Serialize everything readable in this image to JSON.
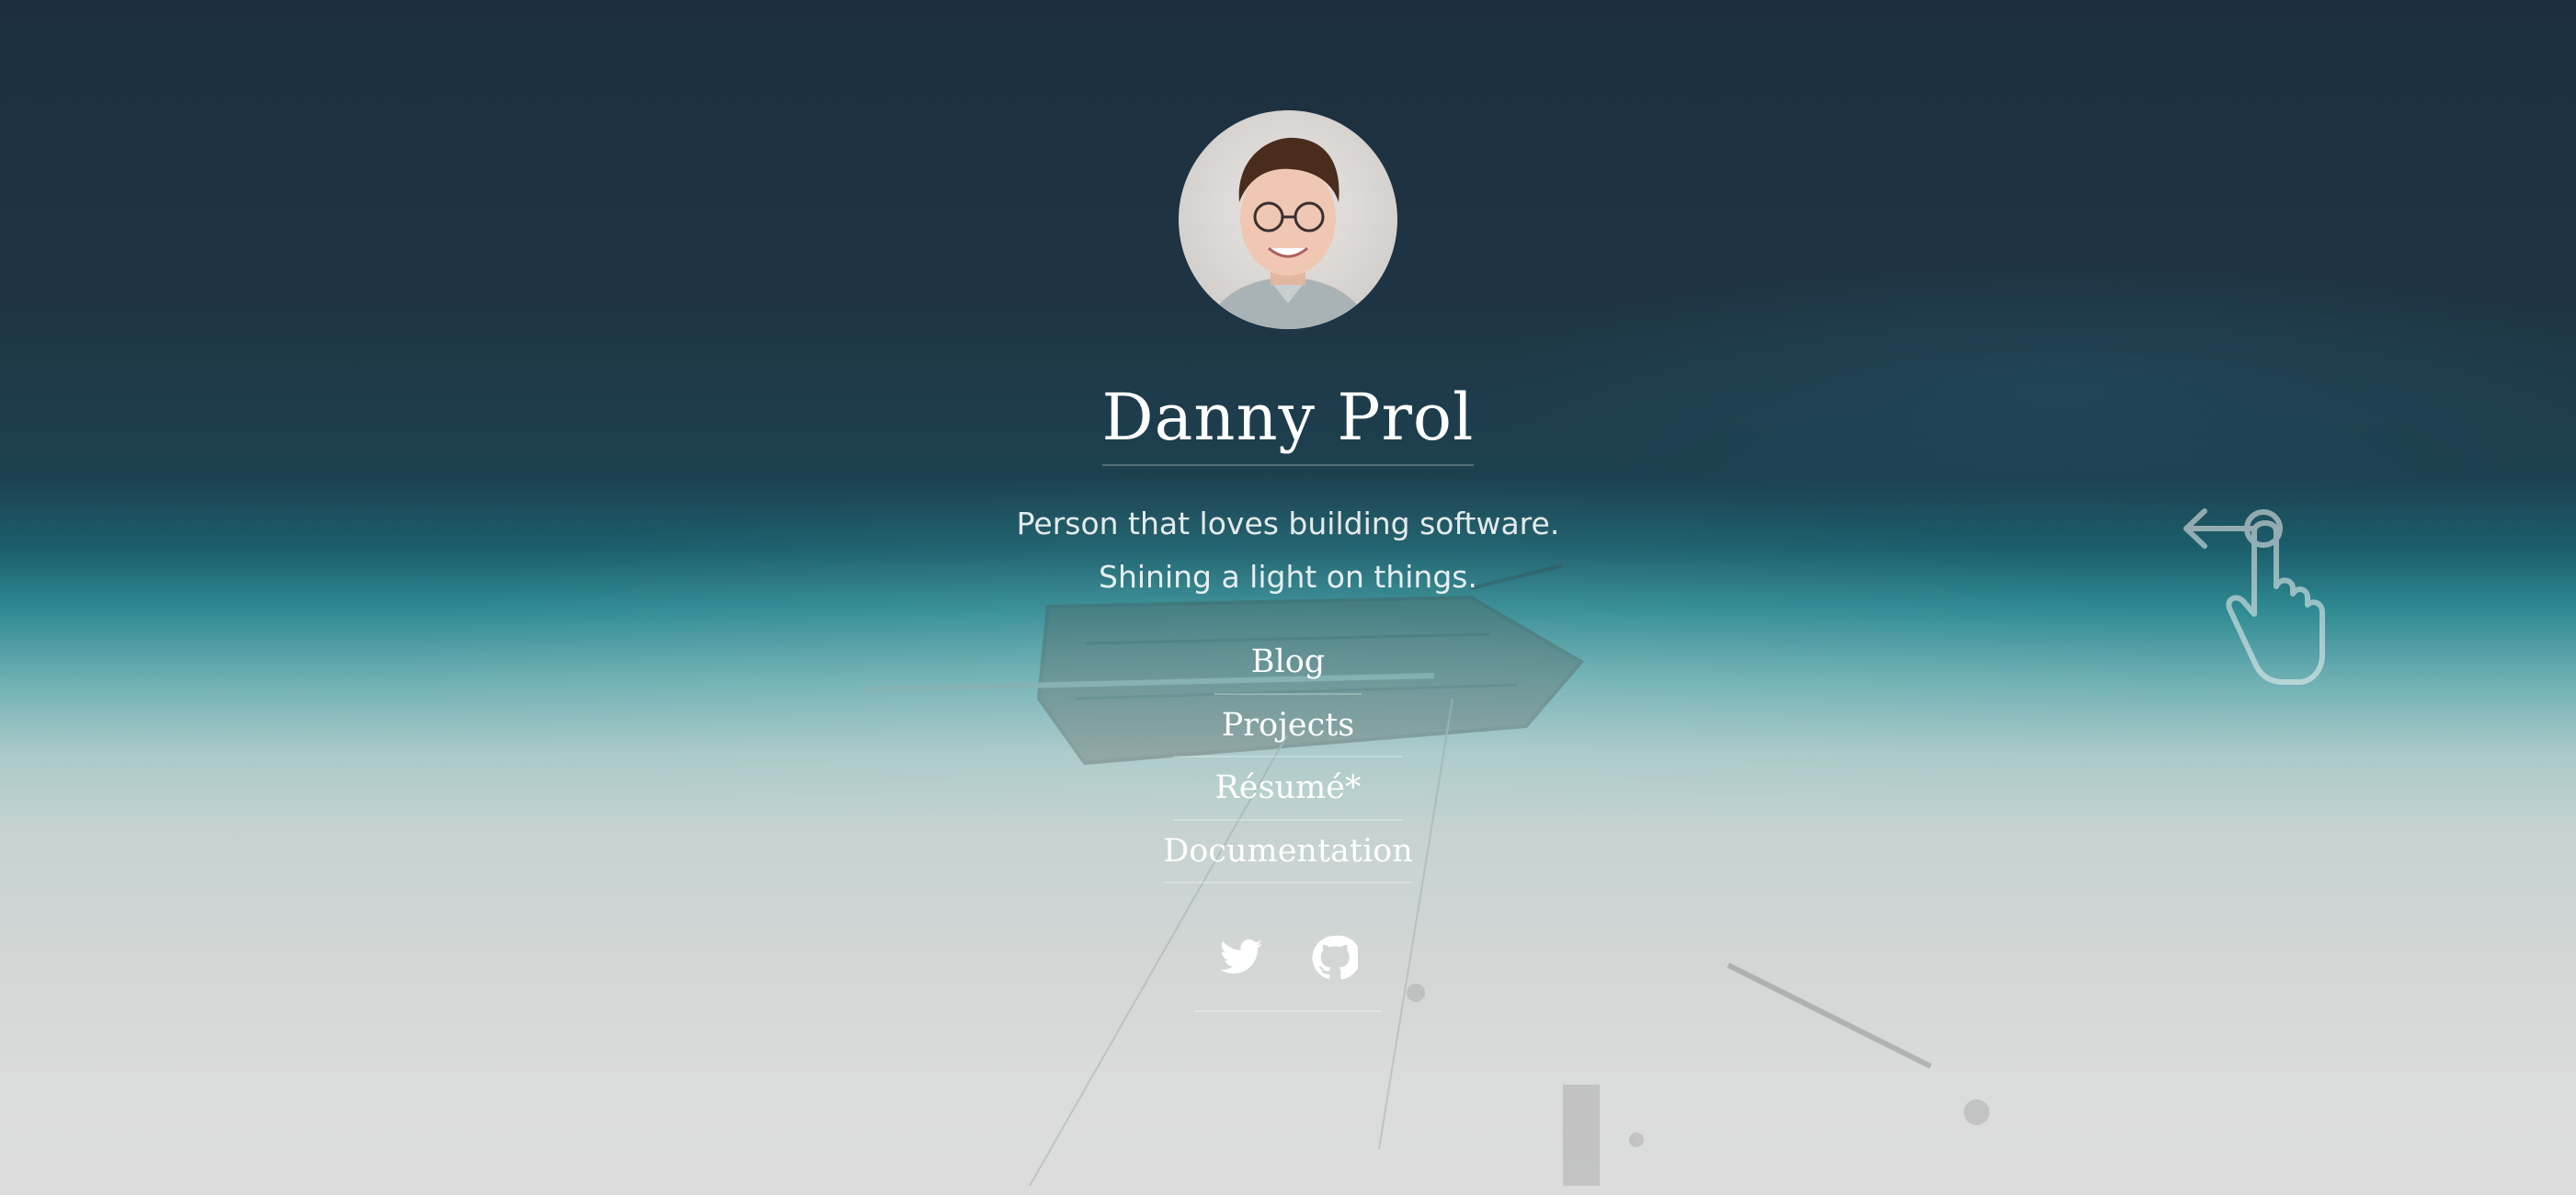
{
  "profile": {
    "name": "Danny Prol",
    "tagline_line1": "Person that loves building software.",
    "tagline_line2": "Shining a light on things.",
    "avatar_icon": "person-photo-icon"
  },
  "nav": {
    "items": [
      {
        "label": "Blog"
      },
      {
        "label": "Projects"
      },
      {
        "label": "Résumé*"
      },
      {
        "label": "Documentation"
      }
    ]
  },
  "social": {
    "twitter_icon": "twitter-icon",
    "github_icon": "github-icon"
  },
  "hint": {
    "icon": "swipe-left-hand-icon"
  },
  "colors": {
    "text": "#ffffff",
    "sky": "#1d2f3f",
    "sea": "#1b5f6c",
    "sand": "#dcdcdc"
  }
}
